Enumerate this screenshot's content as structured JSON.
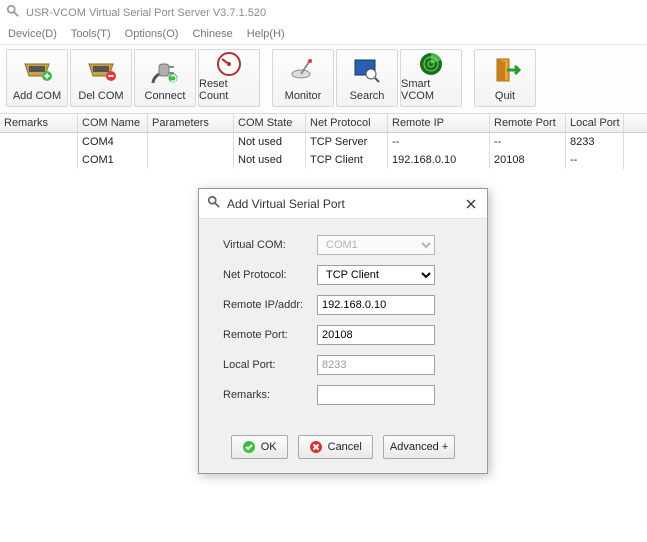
{
  "window": {
    "title": "USR-VCOM Virtual Serial Port Server V3.7.1.520"
  },
  "menu": {
    "device": "Device(D)",
    "tools": "Tools(T)",
    "options": "Options(O)",
    "chinese": "Chinese",
    "help": "Help(H)"
  },
  "toolbar": {
    "add": "Add COM",
    "del": "Del COM",
    "connect": "Connect",
    "reset": "Reset Count",
    "monitor": "Monitor",
    "search": "Search",
    "smart": "Smart VCOM",
    "quit": "Quit"
  },
  "columns": {
    "remarks": "Remarks",
    "comname": "COM Name",
    "params": "Parameters",
    "state": "COM State",
    "proto": "Net Protocol",
    "rip": "Remote IP",
    "rport": "Remote Port",
    "lport": "Local Port"
  },
  "rows": [
    {
      "remarks": "",
      "comname": "COM4",
      "params": "",
      "state": "Not used",
      "proto": "TCP Server",
      "rip": "--",
      "rport": "--",
      "lport": "8233"
    },
    {
      "remarks": "",
      "comname": "COM1",
      "params": "",
      "state": "Not used",
      "proto": "TCP Client",
      "rip": "192.168.0.10",
      "rport": "20108",
      "lport": "--"
    }
  ],
  "dialog": {
    "title": "Add Virtual Serial Port",
    "labels": {
      "vcom": "Virtual COM:",
      "proto": "Net Protocol:",
      "rip": "Remote IP/addr:",
      "rport": "Remote Port:",
      "lport": "Local Port:",
      "remarks": "Remarks:"
    },
    "values": {
      "vcom": "COM1",
      "proto": "TCP Client",
      "rip": "192.168.0.10",
      "rport": "20108",
      "lport": "8233",
      "remarks": ""
    },
    "buttons": {
      "ok": "OK",
      "cancel": "Cancel",
      "advanced": "Advanced +"
    }
  }
}
